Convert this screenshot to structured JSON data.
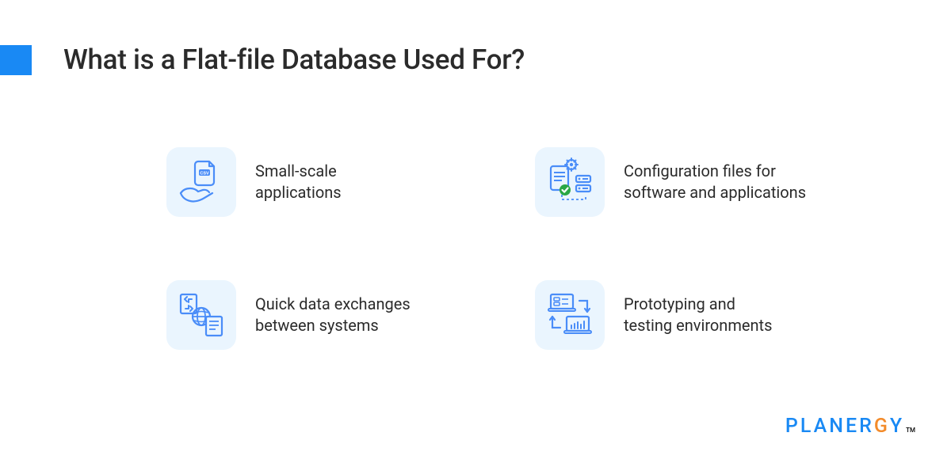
{
  "header": {
    "accent_color": "#1989f4",
    "title": "What is a Flat-file Database Used For?"
  },
  "icon_tile_bg": "#eaf5fe",
  "icon_stroke": "#4a8df8",
  "icon_accent": "#2aa745",
  "items": [
    {
      "icon": "csv-hand",
      "label": "Small-scale\napplications"
    },
    {
      "icon": "config-gear",
      "label": "Configuration files for\nsoftware and applications"
    },
    {
      "icon": "exchange-globe",
      "label": "Quick data exchanges\nbetween systems"
    },
    {
      "icon": "prototype-laptops",
      "label": "Prototyping and\ntesting environments"
    }
  ],
  "brand": {
    "text": "PLANERGY",
    "primary_color": "#1989f4",
    "accent_color": "#f38b2a",
    "tm": "TM"
  }
}
